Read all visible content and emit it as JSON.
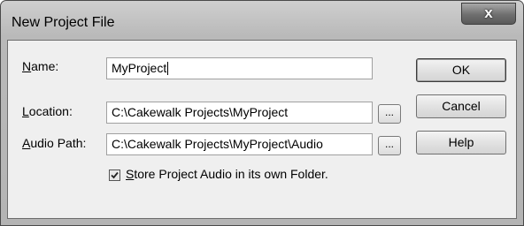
{
  "window": {
    "title": "New Project File",
    "close_glyph": "x"
  },
  "form": {
    "name": {
      "label_key": "N",
      "label_rest": "ame:",
      "value": "MyProject"
    },
    "location": {
      "label_key": "L",
      "label_rest": "ocation:",
      "value": "C:\\Cakewalk Projects\\MyProject",
      "browse_label": "..."
    },
    "audio_path": {
      "label_key": "A",
      "label_rest": "udio Path:",
      "value": "C:\\Cakewalk Projects\\MyProject\\Audio",
      "browse_label": "..."
    },
    "store_audio": {
      "checked": true,
      "label_key": "S",
      "label_rest": "tore Project Audio in its own Folder."
    }
  },
  "buttons": {
    "ok": "OK",
    "cancel": "Cancel",
    "help": "Help"
  }
}
